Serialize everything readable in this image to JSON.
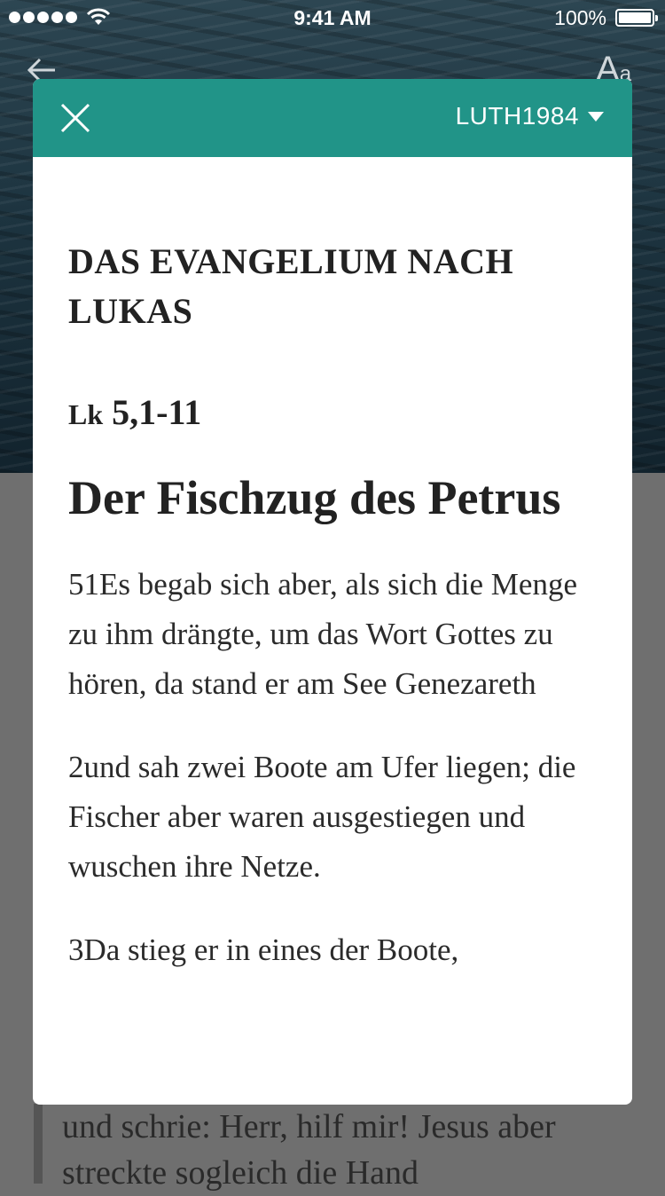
{
  "status_bar": {
    "time": "9:41 AM",
    "battery": "100%"
  },
  "background": {
    "text": "und schrie: Herr, hilf mir! Jesus aber streckte sogleich die Hand"
  },
  "modal": {
    "version": "LUTH1984",
    "book_title": "DAS EVANGELIUM NACH LUKAS",
    "reference_book": "Lk",
    "reference_range": "5,1-11",
    "section_title": "Der Fischzug des Petrus",
    "verses": [
      "51Es begab sich aber, als sich die Menge zu ihm drängte, um das Wort Gottes zu hören, da stand er am See Genezareth",
      "2und sah zwei Boote am Ufer liegen; die Fischer aber waren ausgestiegen und wuschen ihre Netze.",
      "3Da stieg er in eines der Boote,"
    ]
  },
  "icons": {
    "close": "close-icon",
    "dropdown": "caret-down-icon",
    "back": "back-arrow-icon",
    "font": "font-size-icon"
  },
  "colors": {
    "header": "#219488",
    "text": "#222222"
  }
}
